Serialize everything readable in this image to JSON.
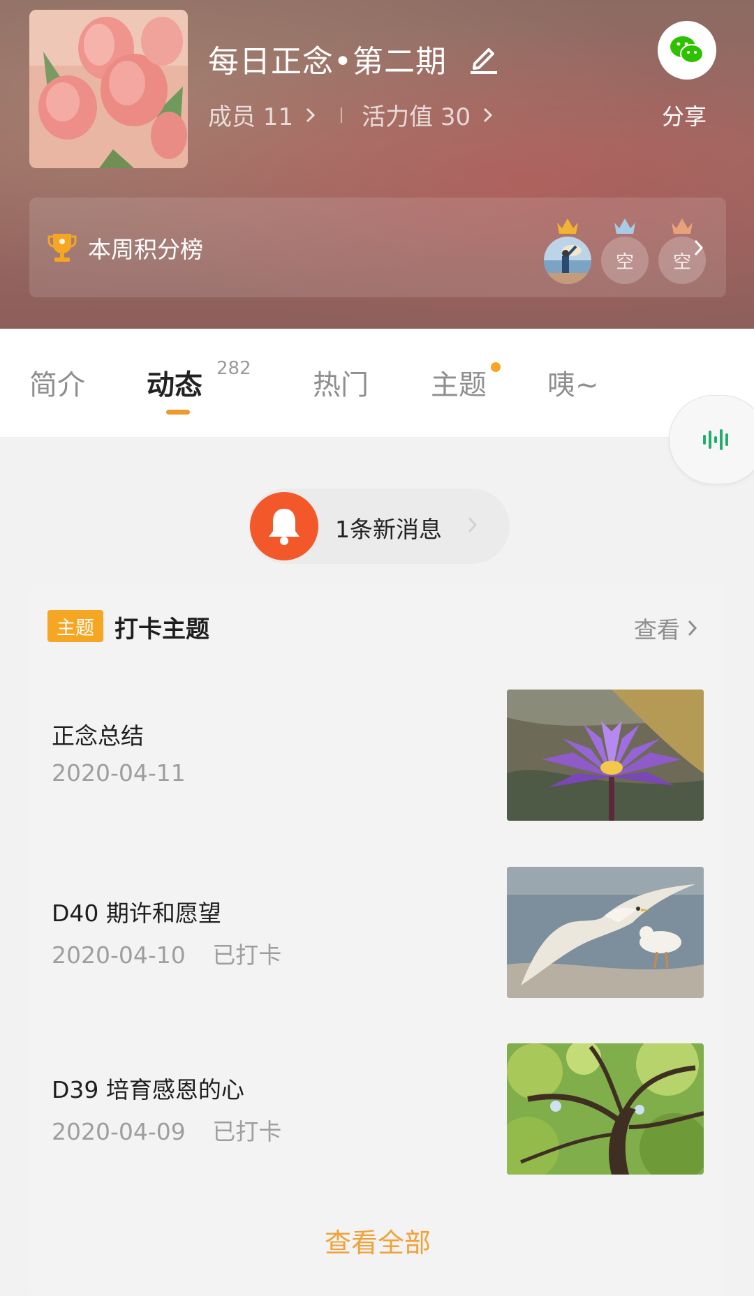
{
  "header": {
    "group_title": "每日正念•第二期",
    "members_label": "成员 11",
    "vitality_label": "活力值 30",
    "share_label": "分享",
    "rank_label": "本周积分榜",
    "rank_slots": [
      {
        "crown_color": "#f2b233",
        "type": "avatar"
      },
      {
        "crown_color": "#a9cbe6",
        "type": "empty",
        "label": "空"
      },
      {
        "crown_color": "#e8a27a",
        "type": "empty",
        "label": "空"
      }
    ]
  },
  "tabs": [
    {
      "label": "简介"
    },
    {
      "label": "动态",
      "count": "282",
      "active": true
    },
    {
      "label": "热门"
    },
    {
      "label": "主题",
      "dot": true
    },
    {
      "label": "咦~"
    }
  ],
  "notice": {
    "text": "1条新消息"
  },
  "topic": {
    "badge": "主题",
    "title": "打卡主题",
    "view_label": "查看",
    "items": [
      {
        "title": "正念总结",
        "date": "2020-04-11",
        "status": "",
        "thumb": "lotus"
      },
      {
        "title": "D40 期许和愿望",
        "date": "2020-04-10",
        "status": "已打卡",
        "thumb": "gulls"
      },
      {
        "title": "D39 培育感恩的心",
        "date": "2020-04-09",
        "status": "已打卡",
        "thumb": "tree"
      }
    ],
    "view_all_label": "查看全部"
  },
  "colors": {
    "accent_orange": "#f5a623",
    "bell_red": "#f2582a",
    "wechat_green": "#2dc100",
    "voice_green": "#1fae6c"
  }
}
